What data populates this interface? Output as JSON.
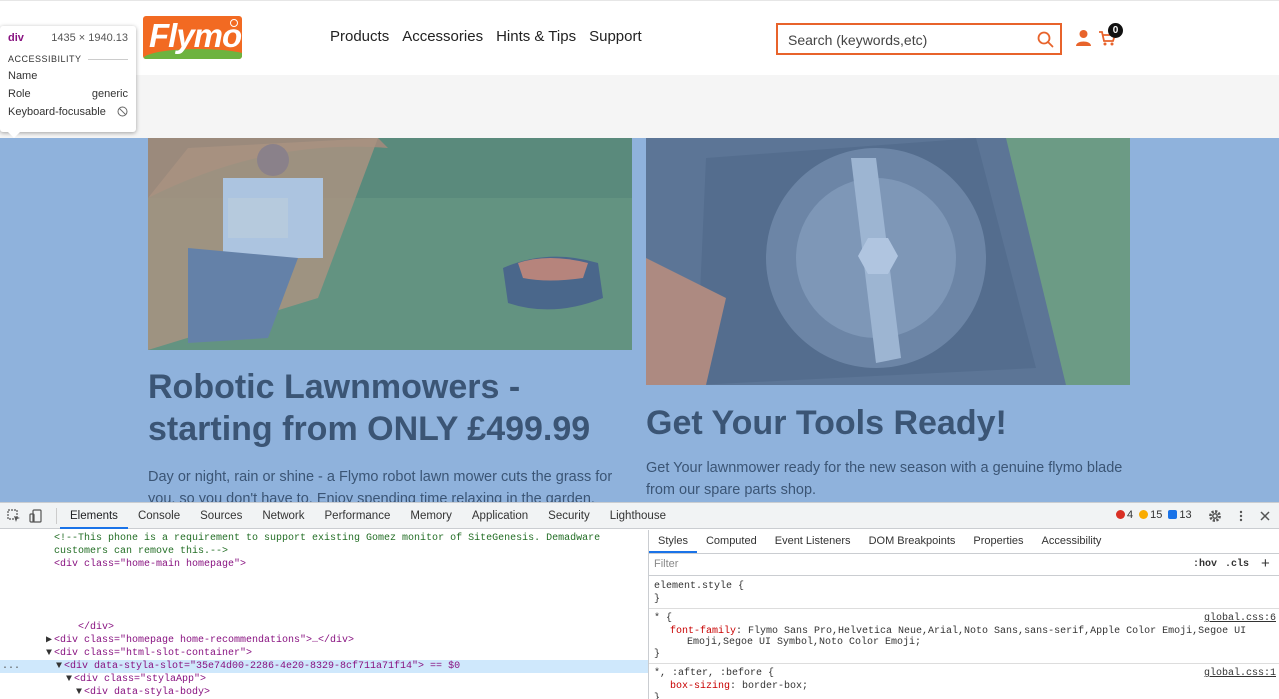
{
  "site": {
    "logo_text": "Flymo",
    "nav": [
      "Products",
      "Accessories",
      "Hints & Tips",
      "Support"
    ],
    "search_placeholder": "Search (keywords,etc)",
    "cart_count": "0",
    "colors": {
      "brand": "#f26a22",
      "highlight": "#8fb2dc",
      "text": "#3b5575"
    }
  },
  "cards": [
    {
      "title": "Robotic Lawnmowers - starting from ONLY £499.99",
      "text": "Day or night, rain or shine - a Flymo robot lawn mower cuts the grass for you, so you don't have to. Enjoy spending time relaxing in the garden."
    },
    {
      "title": "Get Your Tools Ready!",
      "text": "Get Your lawnmower ready for the new season with a genuine flymo blade from our spare parts shop."
    }
  ],
  "tooltip": {
    "tag": "div",
    "size": "1435 × 1940.13",
    "section": "ACCESSIBILITY",
    "rows": [
      {
        "label": "Name",
        "value": ""
      },
      {
        "label": "Role",
        "value": "generic"
      },
      {
        "label": "Keyboard-focusable",
        "value": ""
      }
    ]
  },
  "devtools": {
    "tabs": [
      "Elements",
      "Console",
      "Sources",
      "Network",
      "Performance",
      "Memory",
      "Application",
      "Security",
      "Lighthouse"
    ],
    "active_tab": "Elements",
    "counts": {
      "errors": "4",
      "warnings": "15",
      "info": "13"
    },
    "dom": {
      "comment_1": "<!--This phone is a requirement to support existing Gomez monitor of SiteGenesis. Demadware",
      "comment_2": "customers can remove this.-->",
      "line_home_main": "<div class=\"home-main homepage\">",
      "line_close_div": "</div>",
      "line_recommendations": "<div class=\"homepage home-recommendations\">…</div>",
      "line_slot_container": "<div class=\"html-slot-container\">",
      "line_selected": "<div data-styla-slot=\"35e74d00-2286-4e20-8329-8cf711a71f14\"> == $0",
      "line_styla_app": "<div class=\"stylaApp\">",
      "line_styla_body": "<div data-styla-body>",
      "ellipsis": "..."
    },
    "styles": {
      "tabs": [
        "Styles",
        "Computed",
        "Event Listeners",
        "DOM Breakpoints",
        "Properties",
        "Accessibility"
      ],
      "active_tab": "Styles",
      "filter_placeholder": "Filter",
      "hov": ":hov",
      "cls": ".cls",
      "plus": "+",
      "element_style": "element.style {",
      "close_brace": "}",
      "rule1_selector": "* {",
      "rule1_link": "global.css:6",
      "rule1_prop": "font-family",
      "rule1_value_1": ": Flymo Sans Pro,Helvetica Neue,Arial,Noto Sans,sans-serif,Apple Color Emoji,Segoe UI",
      "rule1_value_2": "Emoji,Segoe UI Symbol,Noto Color Emoji;",
      "rule2_selector": "*, :after, :before {",
      "rule2_link": "global.css:1",
      "rule2_prop": "box-sizing",
      "rule2_value": ": border-box;"
    }
  }
}
